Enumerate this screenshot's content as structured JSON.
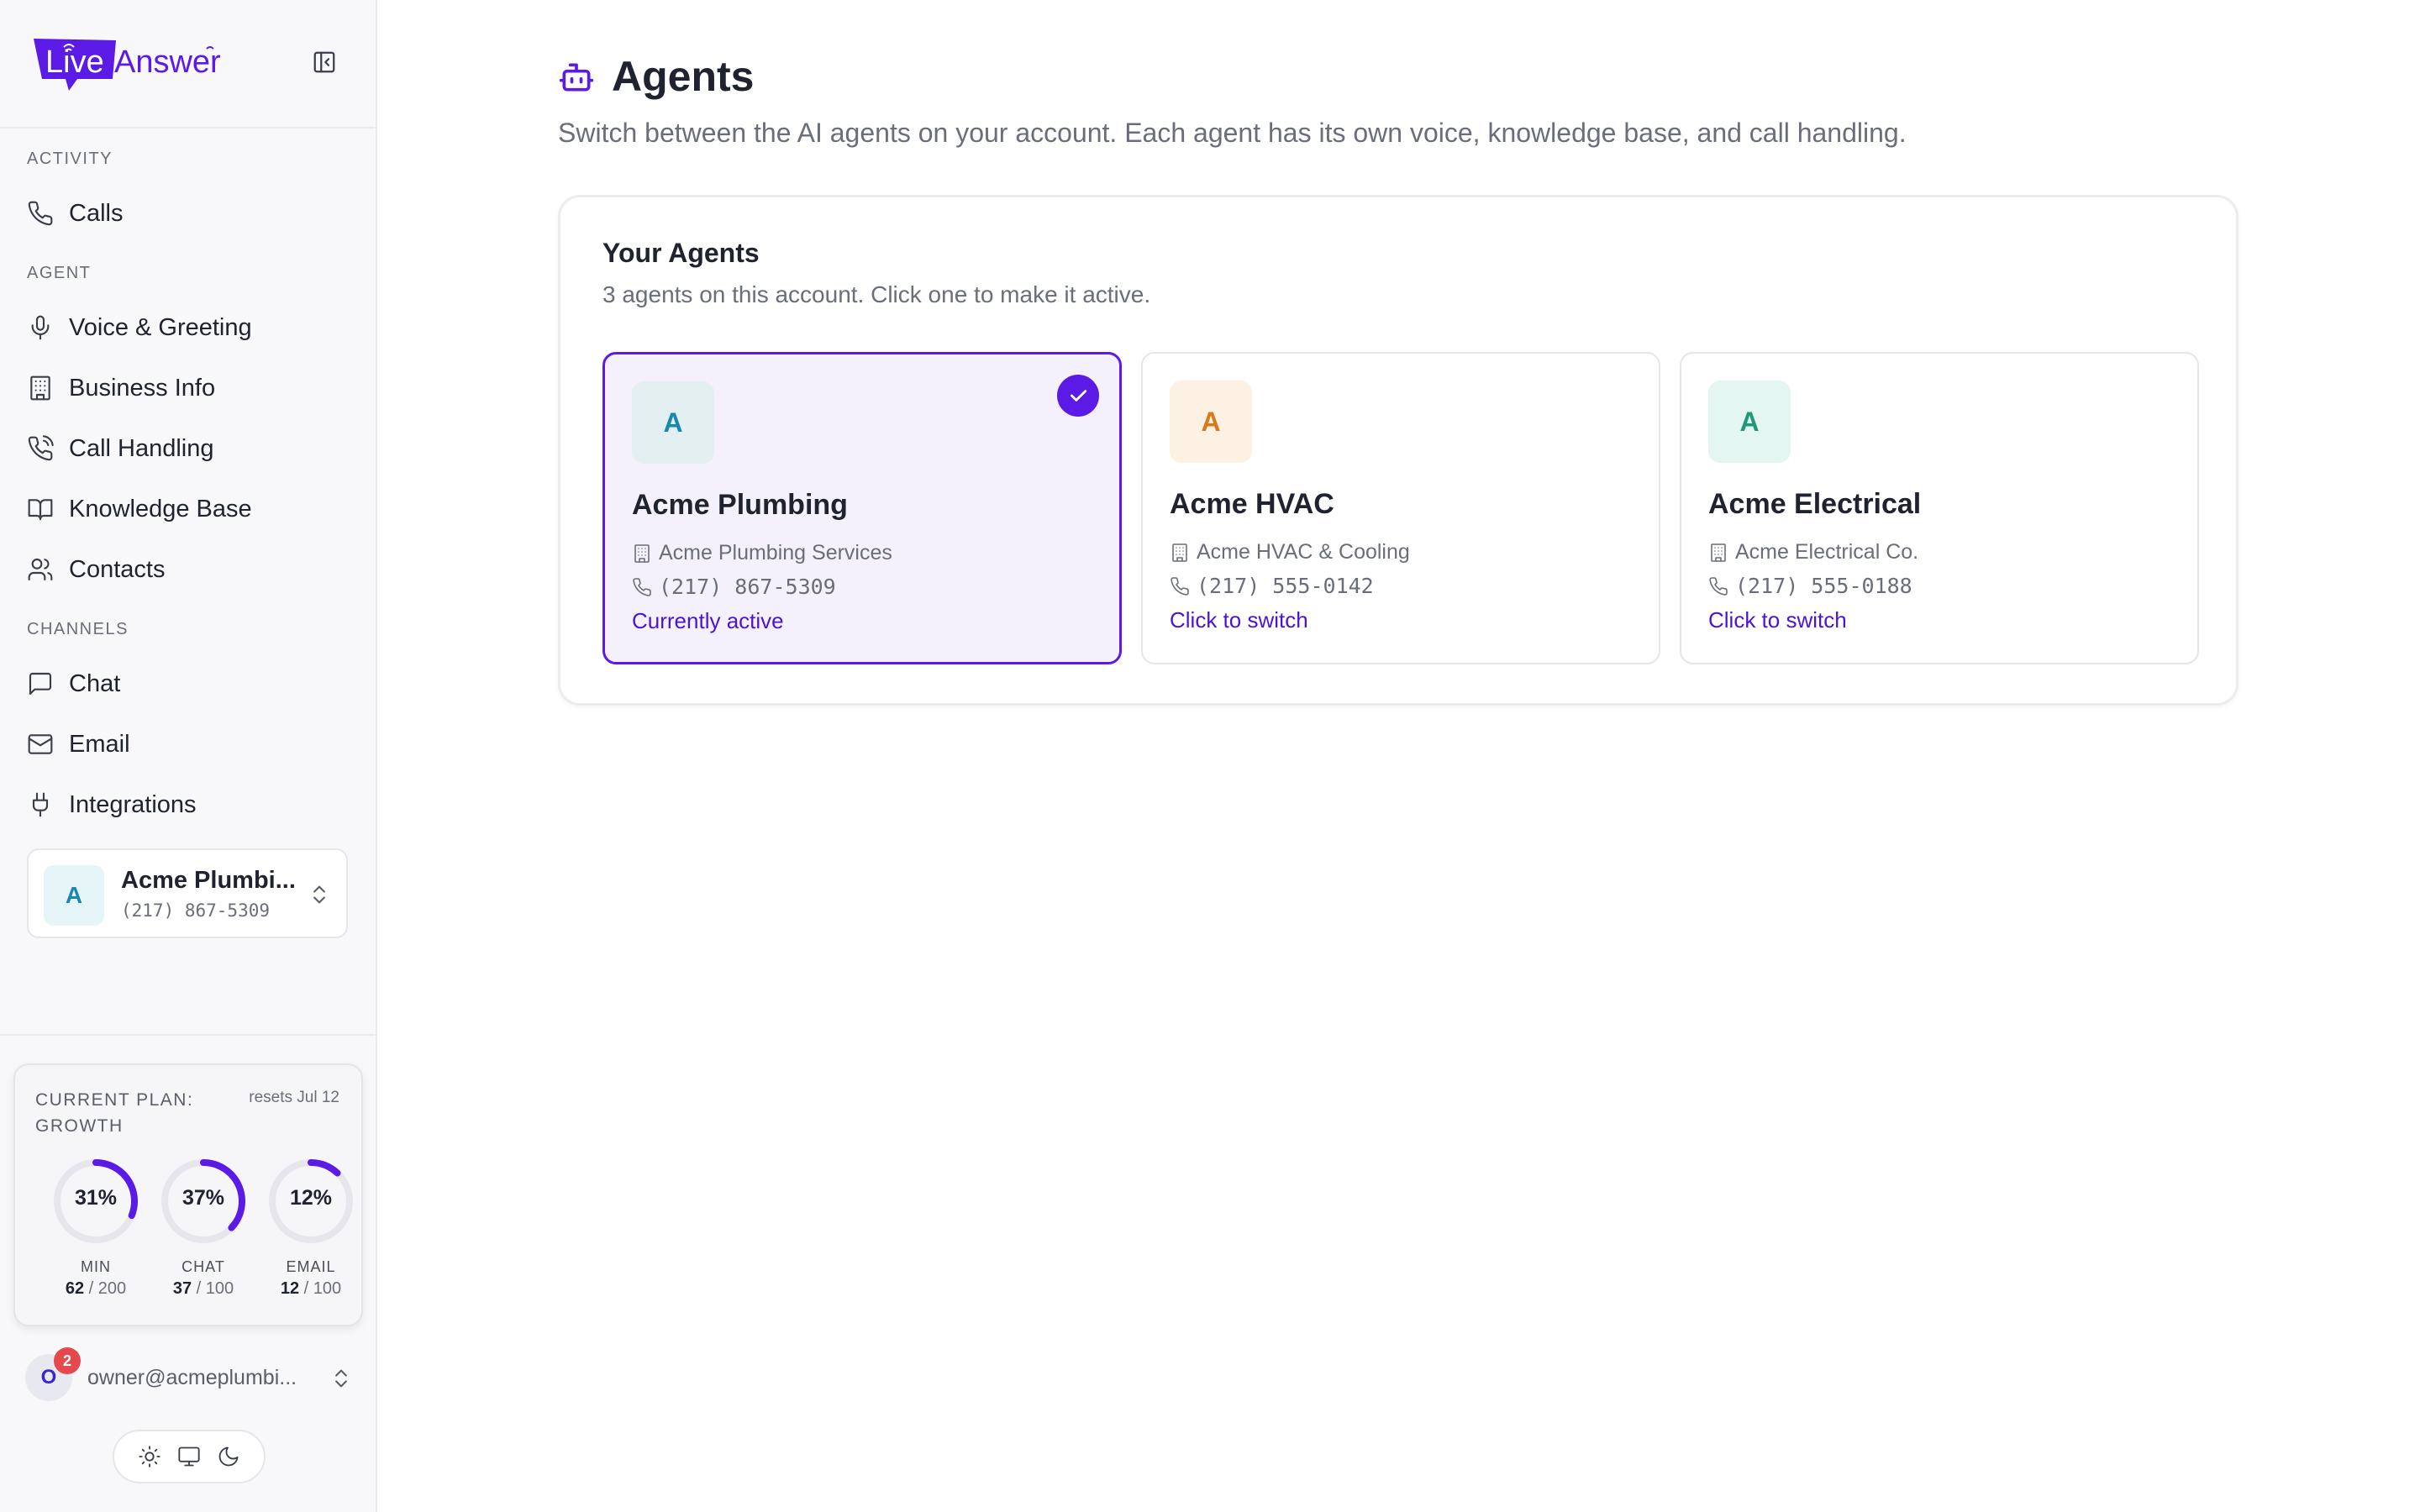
{
  "app": {
    "logo_text_live": "Live",
    "logo_text_answer": "Answer"
  },
  "sidebar": {
    "sections": {
      "activity": "ACTIVITY",
      "agent": "AGENT",
      "channels": "CHANNELS"
    },
    "items": [
      {
        "label": "Calls",
        "icon": "phone-icon"
      },
      {
        "label": "Voice & Greeting",
        "icon": "microphone-icon"
      },
      {
        "label": "Business Info",
        "icon": "building-icon"
      },
      {
        "label": "Call Handling",
        "icon": "phone-call-icon"
      },
      {
        "label": "Knowledge Base",
        "icon": "book-open-icon"
      },
      {
        "label": "Contacts",
        "icon": "users-icon"
      },
      {
        "label": "Chat",
        "icon": "message-square-icon"
      },
      {
        "label": "Email",
        "icon": "mail-icon"
      },
      {
        "label": "Integrations",
        "icon": "plug-icon"
      }
    ],
    "agent_switcher": {
      "initial": "A",
      "name": "Acme Plumbi...",
      "phone": "(217) 867-5309"
    },
    "plan": {
      "title": "CURRENT PLAN: GROWTH",
      "reset": "resets Jul 12",
      "gauges": [
        {
          "percent_label": "31%",
          "fraction": 0.31,
          "label": "MIN",
          "used": "62",
          "total": "/ 200"
        },
        {
          "percent_label": "37%",
          "fraction": 0.37,
          "label": "CHAT",
          "used": "37",
          "total": "/ 100"
        },
        {
          "percent_label": "12%",
          "fraction": 0.12,
          "label": "EMAIL",
          "used": "12",
          "total": "/ 100"
        }
      ]
    },
    "user": {
      "initial": "O",
      "badge": "2",
      "email": "owner@acmeplumbi..."
    }
  },
  "main": {
    "title": "Agents",
    "subtitle": "Switch between the AI agents on your account. Each agent has its own voice, knowledge base, and call handling.",
    "panel": {
      "title": "Your Agents",
      "subtitle": "3 agents on this account. Click one to make it active.",
      "agents": [
        {
          "initial": "A",
          "name": "Acme Plumbing",
          "business": "Acme Plumbing Services",
          "phone": "(217) 867-5309",
          "action": "Currently active",
          "active": true
        },
        {
          "initial": "A",
          "name": "Acme HVAC",
          "business": "Acme HVAC & Cooling",
          "phone": "(217) 555-0142",
          "action": "Click to switch",
          "active": false
        },
        {
          "initial": "A",
          "name": "Acme Electrical",
          "business": "Acme Electrical Co.",
          "phone": "(217) 555-0188",
          "action": "Click to switch",
          "active": false
        }
      ]
    }
  },
  "colors": {
    "accent": "#5b1ae6",
    "link": "#4a14d8",
    "gauge_track": "#e6e6ec",
    "avatar_blue_bg": "#e4f4f7",
    "avatar_blue_fg": "#1b86b0",
    "avatar_orange_bg": "#fdf1e3",
    "avatar_orange_fg": "#d9791a",
    "avatar_teal_bg": "#e3f6f1",
    "avatar_teal_fg": "#1e9a7a"
  }
}
